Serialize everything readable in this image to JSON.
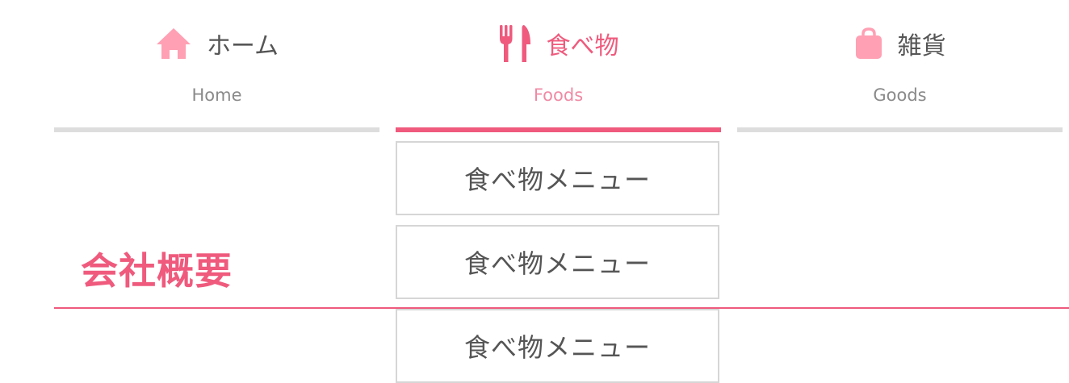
{
  "nav": {
    "items": [
      {
        "label": "ホーム",
        "sub": "Home",
        "icon": "home-icon"
      },
      {
        "label": "食べ物",
        "sub": "Foods",
        "icon": "fork-knife-icon"
      },
      {
        "label": "雑貨",
        "sub": "Goods",
        "icon": "shopping-bag-icon"
      }
    ],
    "active_index": 1
  },
  "dropdown": {
    "items": [
      {
        "label": "食べ物メニュー"
      },
      {
        "label": "食べ物メニュー"
      },
      {
        "label": "食べ物メニュー"
      }
    ]
  },
  "section": {
    "title": "会社概要"
  },
  "colors": {
    "accent": "#ef5a7d",
    "accent_light": "#ffa0b4",
    "text": "#555555",
    "muted": "#8a8a8a",
    "inactive_bar": "#dddddd"
  }
}
